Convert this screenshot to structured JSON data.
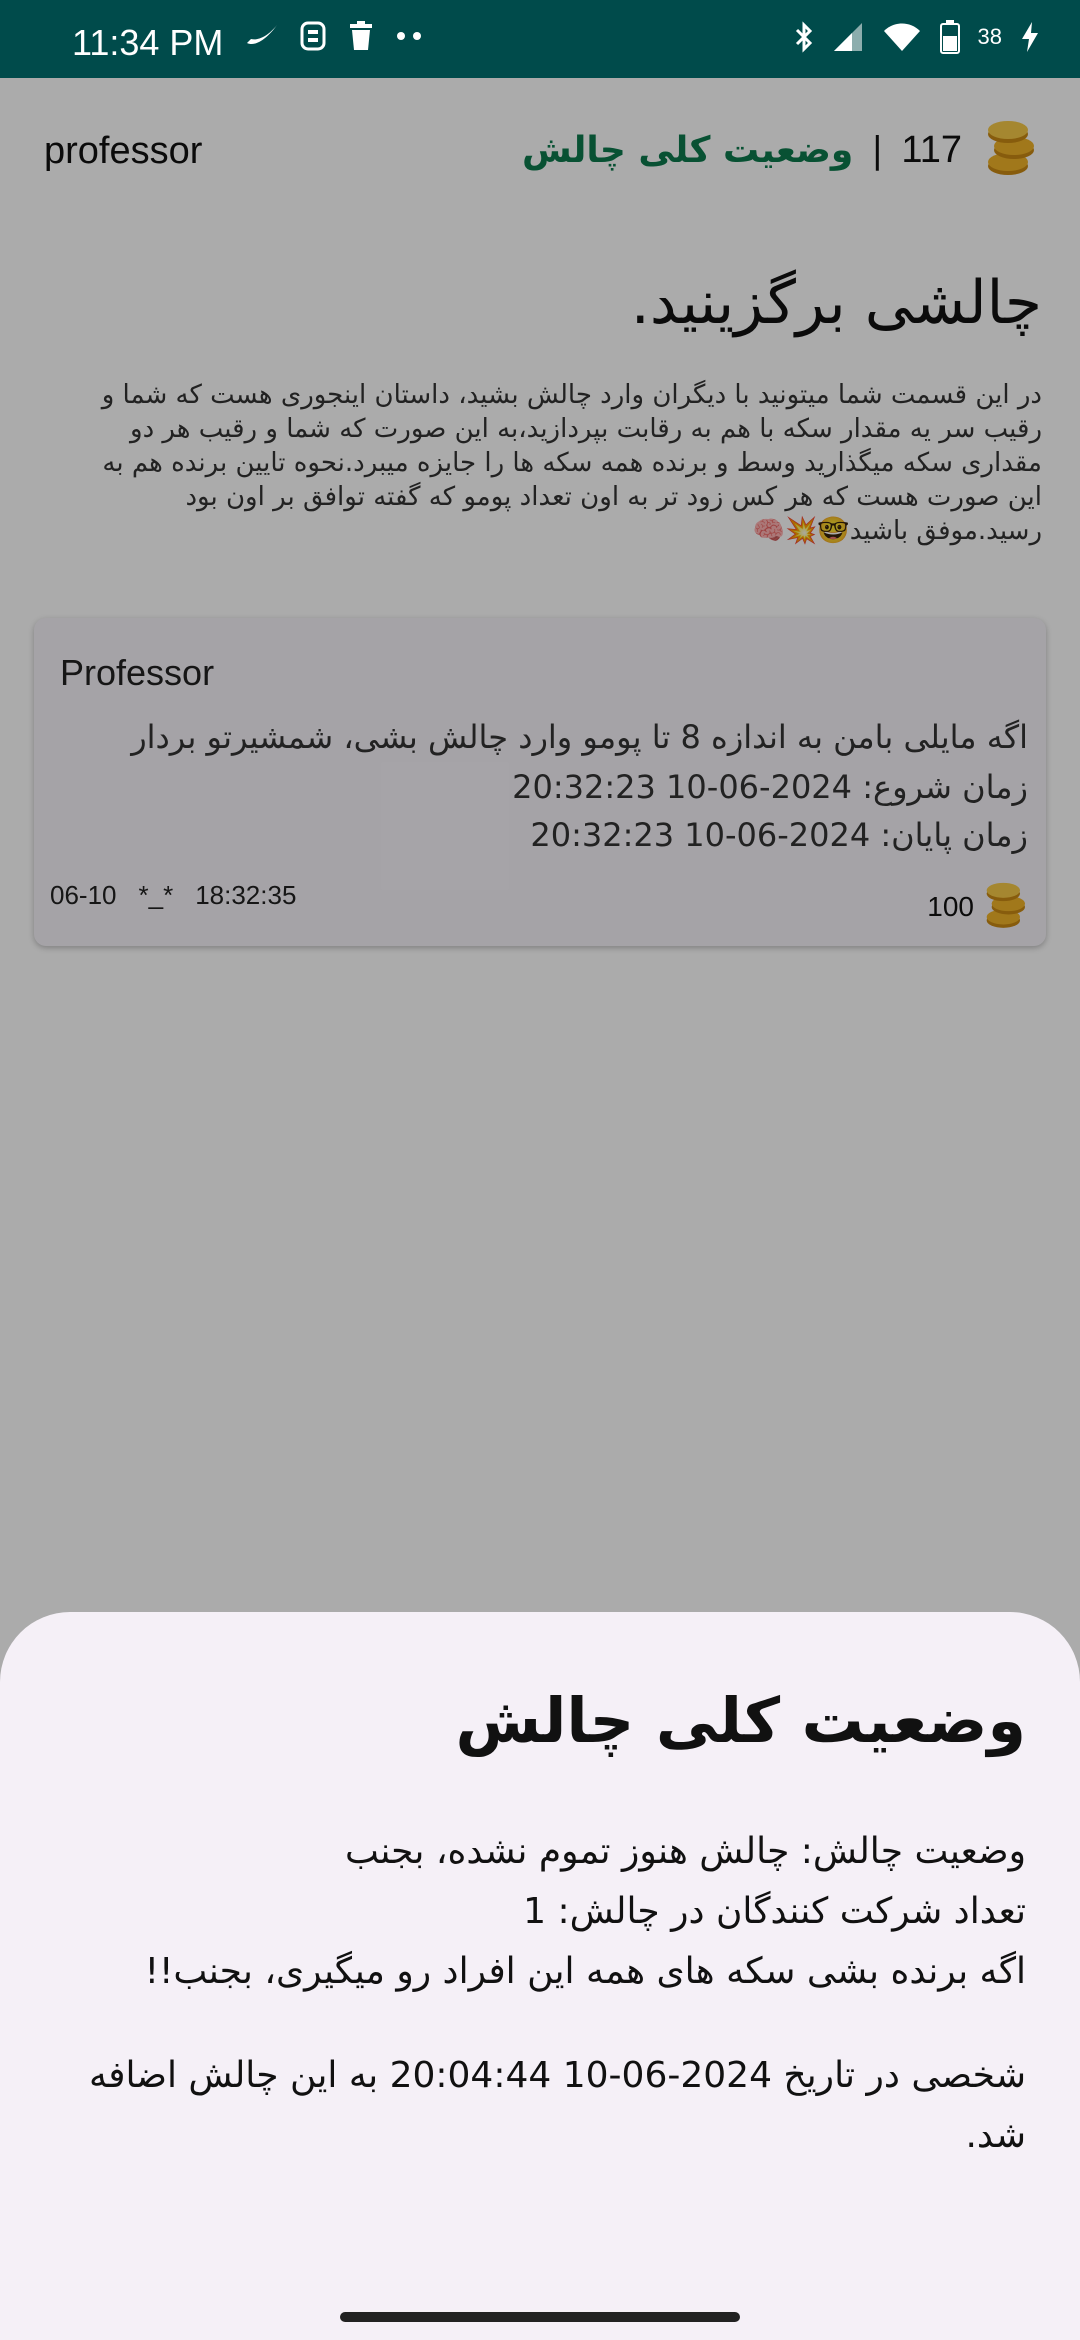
{
  "status_bar": {
    "time": "11:34 PM",
    "battery": "38",
    "icons": [
      "nike-icon",
      "app-icon",
      "trash-icon",
      "more-dots-icon",
      "bluetooth-icon",
      "signal-icon",
      "wifi-icon",
      "battery-icon",
      "charging-icon"
    ]
  },
  "header": {
    "username": "professor",
    "status_link": "وضعیت کلی چالش",
    "separator": "|",
    "coins": "117"
  },
  "page": {
    "title": "چالشی برگزینید.",
    "intro": "در این قسمت شما میتونید با دیگران وارد چالش بشید، داستان اینجوری هست که شما و رقیب سر یه مقدار سکه با هم به رقابت بپردازید،به این صورت که شما و رقیب هر دو مقداری سکه میگذارید وسط و برنده همه سکه ها را جایزه میبرد.نحوه تایین برنده هم به این صورت هست که هر کس زود تر به اون تعداد پومو که گفته توافق بر اون بود رسید.موفق باشید🤓💥🧠"
  },
  "card": {
    "author": "Professor",
    "description": "اگه مایلی بامن به اندازه 8 تا پومو وارد چالش بشی، شمشیرتو بردار",
    "start": "زمان شروع: 2024-06-10 20:32:23",
    "end": "زمان پایان: 2024-06-10 20:32:23",
    "meta_date": "06-10",
    "meta_face": "*_*",
    "meta_time": "18:32:35",
    "coins": "100"
  },
  "sheet": {
    "title": "وضعیت کلی چالش",
    "line1": "وضعیت چالش: چالش هنوز تموم نشده، بجنب",
    "line2": "تعداد شرکت کنندگان در چالش: 1",
    "line3": "اگه برنده بشی سکه های همه این افراد رو میگیری، بجنب!!",
    "line4": "شخصی در تاریخ 2024-06-10 20:04:44 به این چالش اضافه شد."
  },
  "colors": {
    "status_bar": "#004b4b",
    "accent_green": "#0c7a4d",
    "sheet_bg": "#f5f0f7"
  }
}
